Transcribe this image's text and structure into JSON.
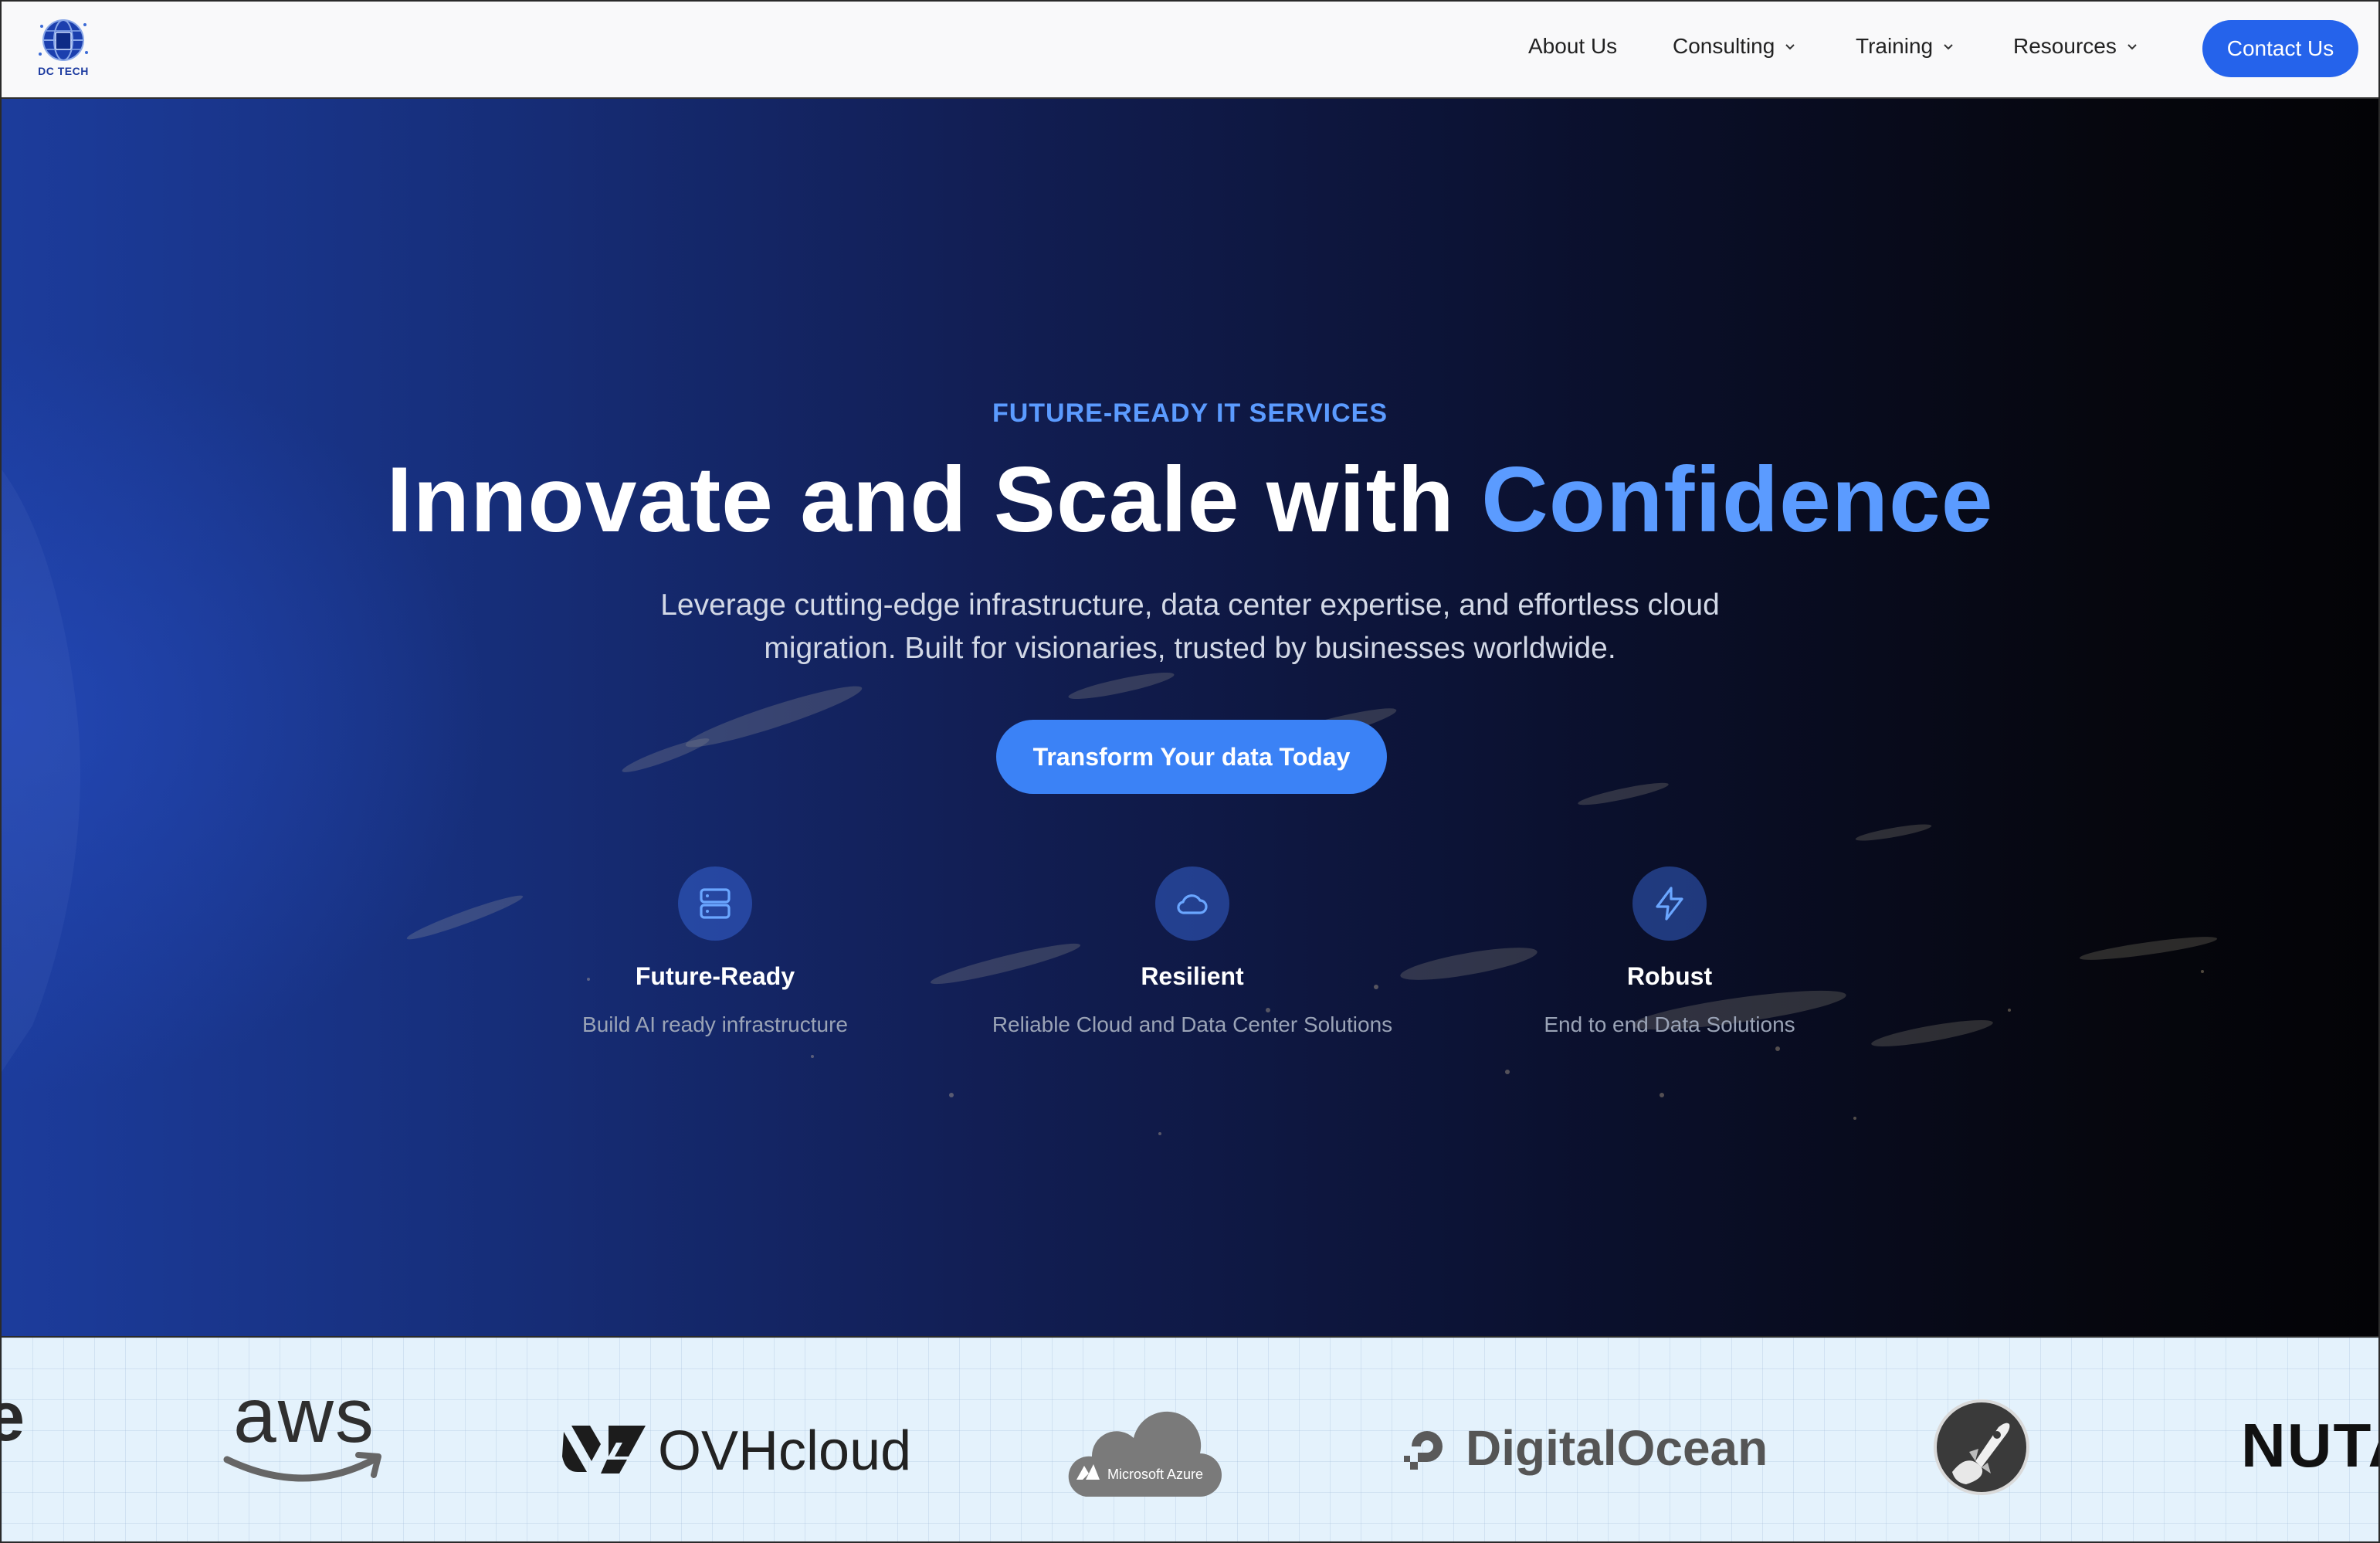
{
  "nav": {
    "logo_text": "DC TECH",
    "items": [
      {
        "label": "About Us",
        "dropdown": false
      },
      {
        "label": "Consulting",
        "dropdown": true
      },
      {
        "label": "Training",
        "dropdown": true
      },
      {
        "label": "Resources",
        "dropdown": true
      }
    ],
    "contact_label": "Contact Us"
  },
  "hero": {
    "eyebrow": "FUTURE-READY IT SERVICES",
    "headline_main": "Innovate and Scale with ",
    "headline_accent": "Confidence",
    "subtitle": "Leverage cutting-edge infrastructure, data center expertise, and effortless cloud migration. Built for visionaries, trusted by businesses worldwide.",
    "cta_label": "Transform Your data Today",
    "features": [
      {
        "icon": "server-icon",
        "title": "Future-Ready",
        "desc": "Build AI ready infrastructure"
      },
      {
        "icon": "cloud-icon",
        "title": "Resilient",
        "desc": "Reliable Cloud and Data Center Solutions"
      },
      {
        "icon": "lightning-icon",
        "title": "Robust",
        "desc": "End to end Data Solutions"
      }
    ]
  },
  "partners": {
    "aws": "aws",
    "ovh": "OVHcloud",
    "azure": "Microsoft Azure",
    "digitalocean": "DigitalOcean",
    "nutanix": "NUTANIX",
    "edge_left": "e"
  },
  "colors": {
    "accent": "#5b9bff",
    "primary_button": "#2563eb",
    "cta_button": "#3b82f6",
    "nav_bg": "#f9f9fa",
    "strip_bg": "#e4f2fc"
  }
}
